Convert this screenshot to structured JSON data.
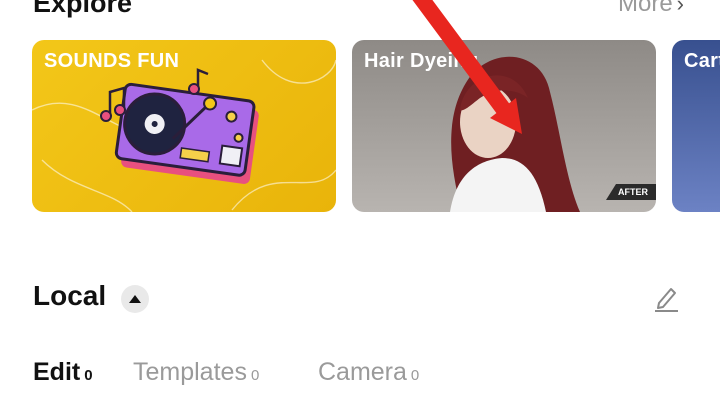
{
  "explore": {
    "title": "Explore",
    "more_label": "More",
    "cards": [
      {
        "title": "SOUNDS FUN",
        "accent": "#f3c719"
      },
      {
        "title": "Hair Dyeing",
        "badge": "AFTER"
      },
      {
        "title": "Cartoon"
      }
    ]
  },
  "local": {
    "title": "Local",
    "tabs": [
      {
        "label": "Edit",
        "count": "0",
        "active": true
      },
      {
        "label": "Templates",
        "count": "0",
        "active": false
      },
      {
        "label": "Camera",
        "count": "0",
        "active": false
      }
    ]
  },
  "icons": {
    "more": "chevron-right-icon",
    "collapse": "caret-up-icon",
    "edit": "pencil-icon",
    "pointer": "red-arrow-annotation"
  },
  "colors": {
    "text": "#111111",
    "muted": "#9a9a9a",
    "annotation": "#e8261f"
  }
}
